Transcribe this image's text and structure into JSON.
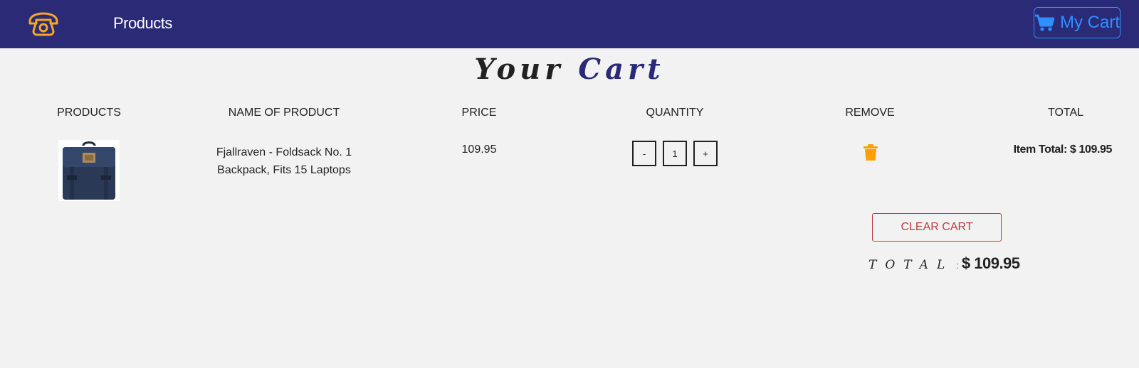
{
  "navbar": {
    "icon": "phone-icon",
    "products_link": "Products",
    "cart_button": {
      "icon": "cart-icon",
      "label": "My Cart"
    },
    "colors": {
      "background": "#2a2a77",
      "accent": "#2f8fff",
      "phone": "#f5a623"
    }
  },
  "page_title": {
    "word1": "Your",
    "word2": "Cart"
  },
  "table": {
    "headers": [
      "PRODUCTS",
      "NAME OF PRODUCT",
      "PRICE",
      "QUANTITY",
      "REMOVE",
      "TOTAL"
    ],
    "rows": [
      {
        "image": "backpack-image",
        "name": "Fjallraven - Foldsack No. 1 Backpack, Fits 15 Laptops",
        "price": "109.95",
        "quantity": "1",
        "decrement": "-",
        "increment": "+",
        "remove_icon": "trash-icon",
        "item_total": "Item Total: $ 109.95"
      }
    ]
  },
  "clear_cart": "CLEAR CART",
  "grand_total": {
    "label": "TOTAL",
    "separator": ":",
    "value": "$ 109.95"
  },
  "colors": {
    "trash": "#ffa000",
    "clear": "#c23a3a"
  }
}
